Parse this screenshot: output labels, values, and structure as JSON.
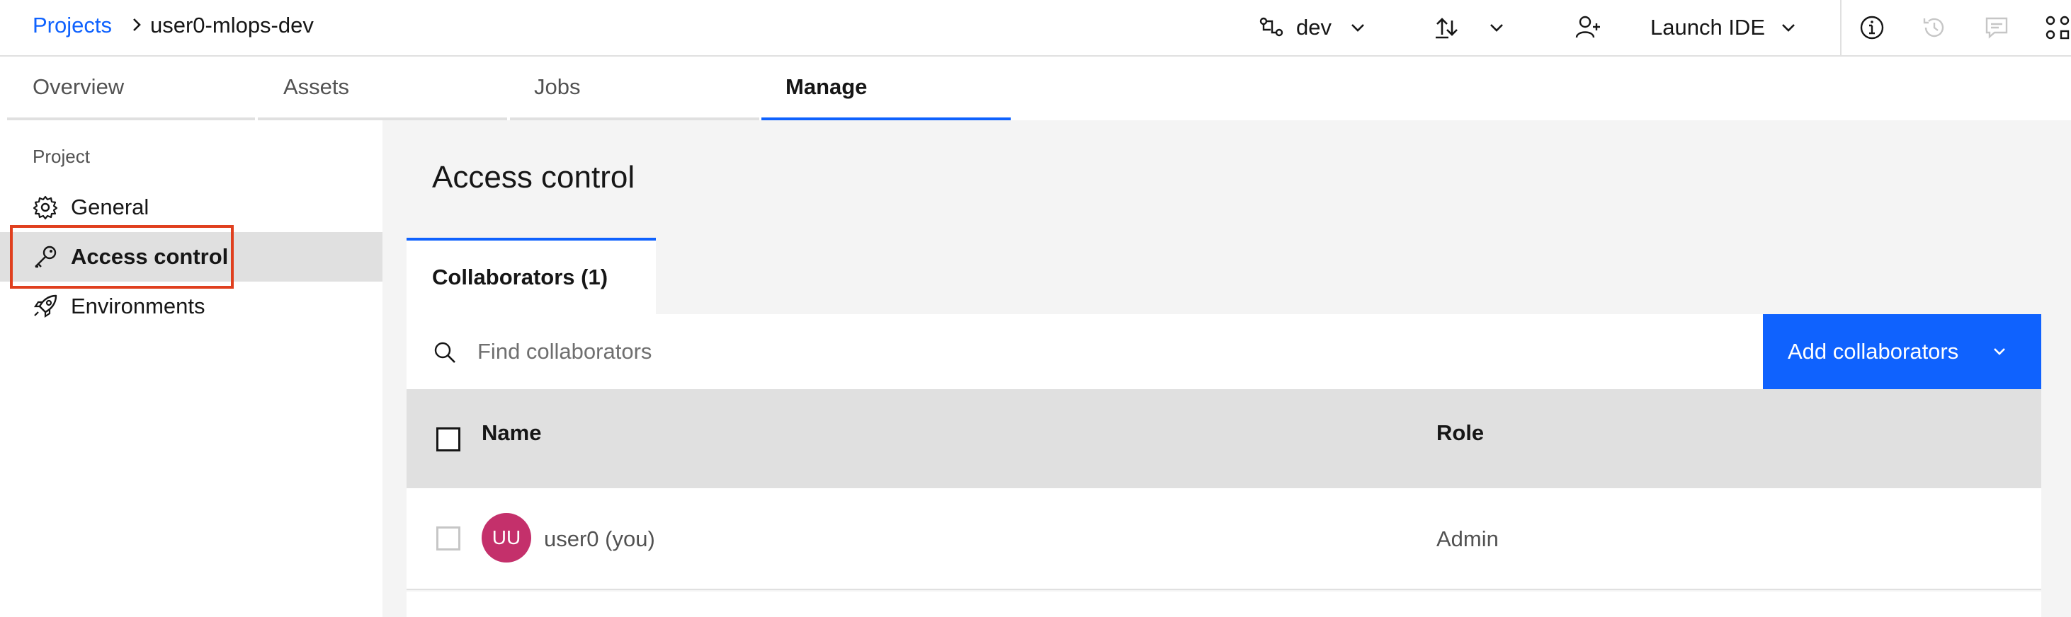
{
  "breadcrumb": {
    "projects": "Projects",
    "current": "user0-mlops-dev"
  },
  "header": {
    "branch": "dev",
    "launch_ide": "Launch IDE"
  },
  "tabs": [
    {
      "label": "Overview"
    },
    {
      "label": "Assets"
    },
    {
      "label": "Jobs"
    },
    {
      "label": "Manage"
    }
  ],
  "sidebar": {
    "heading": "Project",
    "items": [
      {
        "label": "General"
      },
      {
        "label": "Access control"
      },
      {
        "label": "Environments"
      }
    ]
  },
  "main": {
    "title": "Access control",
    "subtab": "Collaborators (1)",
    "search_placeholder": "Find collaborators",
    "add_button": "Add collaborators",
    "columns": {
      "name": "Name",
      "role": "Role"
    },
    "rows": [
      {
        "initials": "UU",
        "name": "user0 (you)",
        "role": "Admin"
      }
    ]
  },
  "colors": {
    "accent": "#0f62fe",
    "highlight": "#e0401f",
    "avatar": "#c4306b"
  }
}
